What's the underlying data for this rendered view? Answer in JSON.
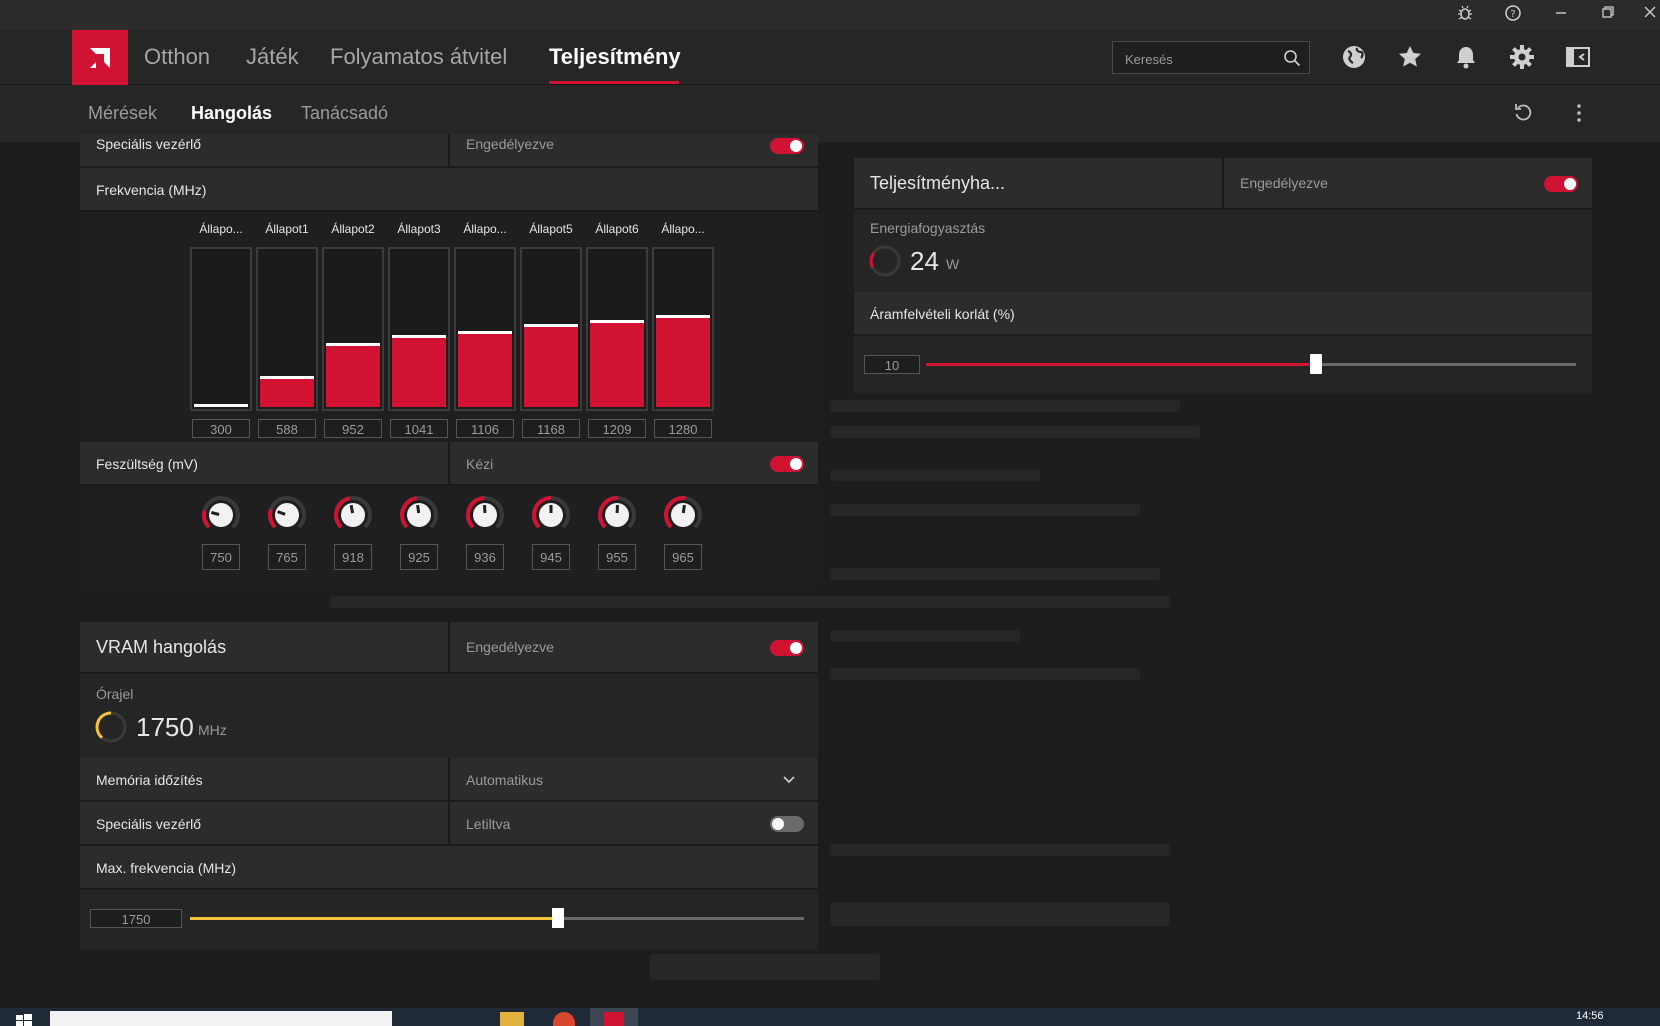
{
  "titlebar": {
    "icons": [
      "bug-icon",
      "help-icon",
      "minimize-icon",
      "restore-icon",
      "close-icon"
    ]
  },
  "nav": {
    "tabs": [
      "Otthon",
      "Játék",
      "Folyamatos átvitel",
      "Teljesítmény"
    ],
    "active_tab": "Teljesítmény",
    "search_placeholder": "Keresés",
    "icons": [
      "globe-icon",
      "star-icon",
      "bell-icon",
      "gear-icon",
      "sidebar-icon"
    ]
  },
  "subnav": {
    "tabs": [
      "Mérések",
      "Hangolás",
      "Tanácsadó"
    ],
    "active_tab": "Hangolás",
    "icons": [
      "reset-icon",
      "more-icon"
    ]
  },
  "gpu_panel": {
    "special_control": {
      "label": "Speciális vezérlő",
      "status": "Engedélyezve",
      "enabled": true
    },
    "frequency": {
      "label": "Frekvencia (MHz)",
      "states": [
        "Állapo...",
        "Állapot1",
        "Állapot2",
        "Állapot3",
        "Állapo...",
        "Állapot5",
        "Állapot6",
        "Állapo..."
      ],
      "values": [
        300,
        588,
        952,
        1041,
        1106,
        1168,
        1209,
        1280
      ],
      "value_labels": [
        "300",
        "588",
        "952",
        "1041",
        "1106",
        "1168",
        "1209",
        "1280"
      ],
      "fill_fraction": [
        0.0,
        0.18,
        0.39,
        0.44,
        0.47,
        0.51,
        0.54,
        0.57
      ]
    },
    "voltage": {
      "label": "Feszültség (mV)",
      "mode": "Kézi",
      "enabled": true,
      "value_labels": [
        "750",
        "765",
        "918",
        "925",
        "936",
        "945",
        "955",
        "965"
      ],
      "level_fraction": [
        0.22,
        0.24,
        0.46,
        0.47,
        0.49,
        0.5,
        0.51,
        0.53
      ]
    }
  },
  "vram_panel": {
    "title": "VRAM hangolás",
    "status": "Engedélyezve",
    "enabled": true,
    "clock": {
      "label": "Órajel",
      "value": "1750",
      "unit": "MHz"
    },
    "memory_timing": {
      "label": "Memória időzítés",
      "value": "Automatikus"
    },
    "special_control": {
      "label": "Speciális vezérlő",
      "status": "Letiltva",
      "enabled": false
    },
    "max_frequency": {
      "label": "Max. frekvencia (MHz)",
      "value": "1750",
      "slider_fraction": 0.6
    }
  },
  "power_panel": {
    "title": "Teljesítményha...",
    "status": "Engedélyezve",
    "enabled": true,
    "consumption": {
      "label": "Energiafogyasztás",
      "value": "24",
      "unit": "W"
    },
    "current_limit": {
      "label": "Áramfelvételi korlát (%)",
      "value": "10",
      "slider_fraction": 0.6
    }
  },
  "taskbar": {
    "time": "14:56"
  },
  "colors": {
    "accent": "#d11233",
    "vram_accent": "#f3c13a",
    "panel": "#252525",
    "row": "#2c2c2c"
  }
}
